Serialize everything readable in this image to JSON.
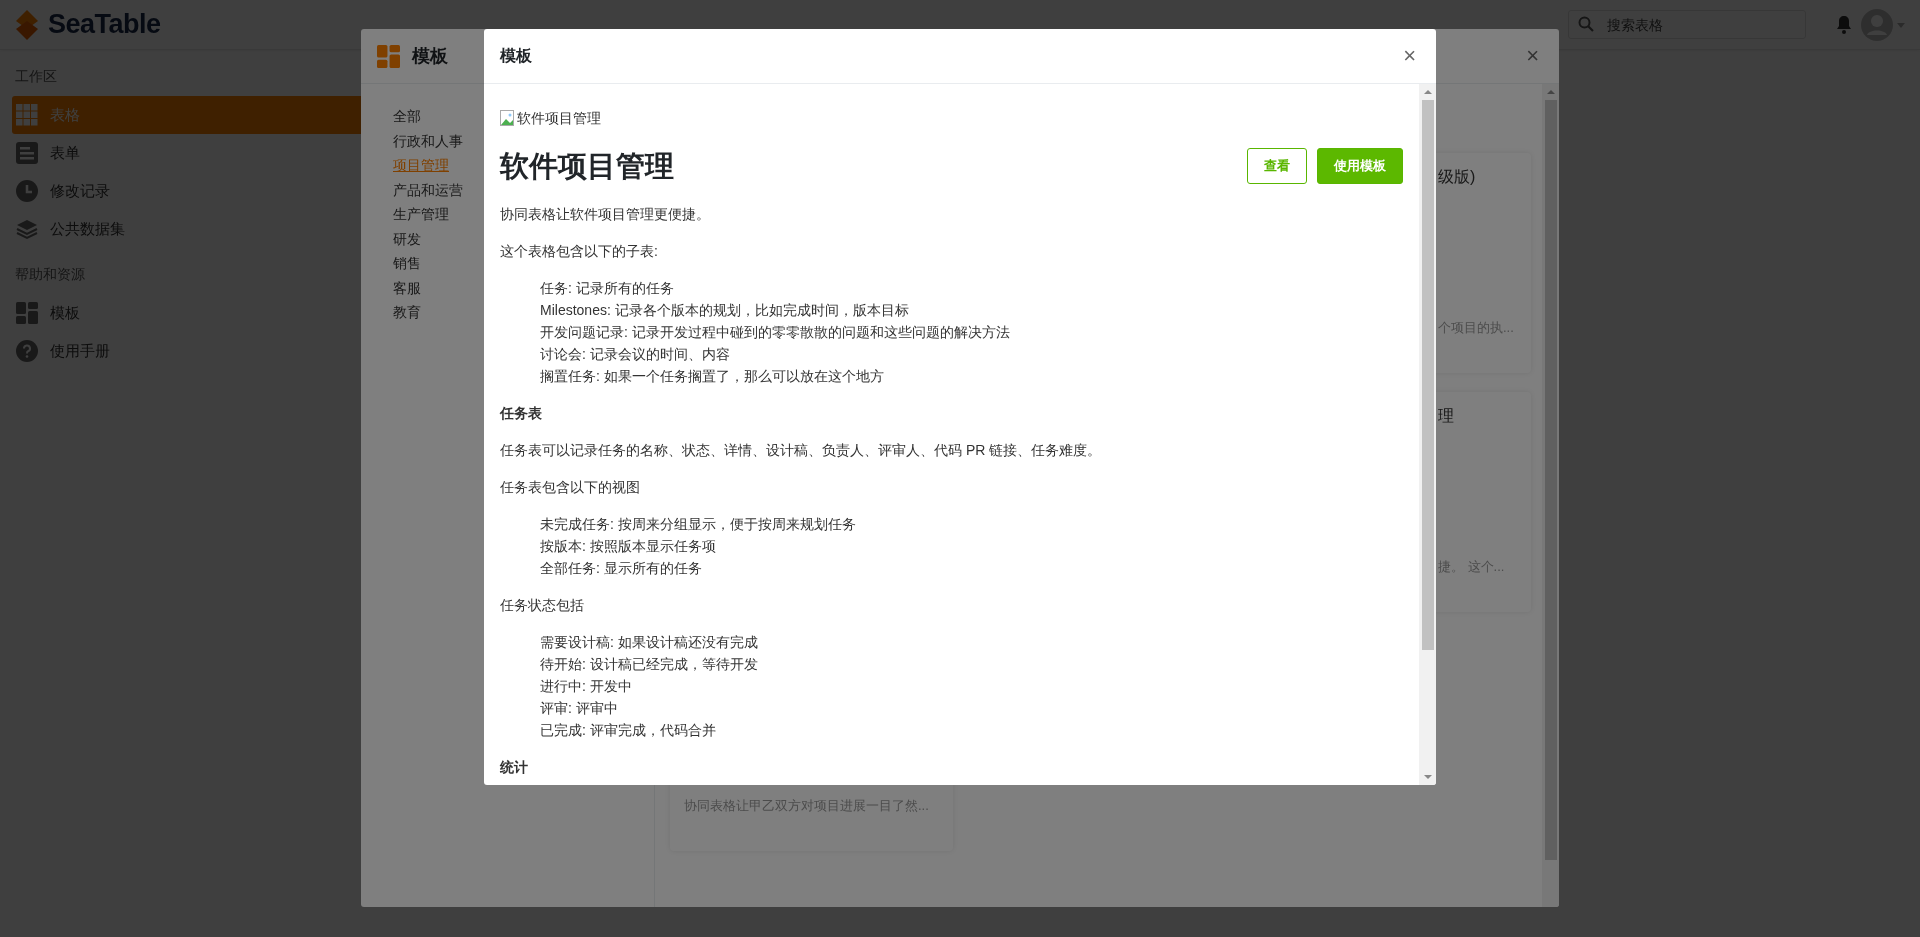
{
  "app": {
    "logo": "SeaTable",
    "search": {
      "placeholder": "搜索表格"
    },
    "sidebar": {
      "sections": [
        {
          "title": "工作区",
          "items": [
            {
              "label": "表格",
              "selected": true
            },
            {
              "label": "表单",
              "selected": false
            },
            {
              "label": "修改记录",
              "selected": false
            },
            {
              "label": "公共数据集",
              "selected": false
            }
          ]
        },
        {
          "title": "帮助和资源",
          "items": [
            {
              "label": "模板",
              "selected": false
            },
            {
              "label": "使用手册",
              "selected": false
            }
          ]
        }
      ]
    }
  },
  "templates_dialog": {
    "title": "模板",
    "close": "×",
    "categories": [
      {
        "label": "全部",
        "selected": false
      },
      {
        "label": "行政和人事",
        "selected": false
      },
      {
        "label": "项目管理",
        "selected": true
      },
      {
        "label": "产品和运营",
        "selected": false
      },
      {
        "label": "生产管理",
        "selected": false
      },
      {
        "label": "研发",
        "selected": false
      },
      {
        "label": "销售",
        "selected": false
      },
      {
        "label": "客服",
        "selected": false
      },
      {
        "label": "教育",
        "selected": false
      }
    ],
    "cards": [
      {
        "title": "级版)",
        "description": "个项目的执..."
      },
      {
        "title": "理",
        "description": "捷。 这个..."
      },
      {
        "description": "协同表格让甲乙双方对项目进展一目了然..."
      }
    ]
  },
  "detail_dialog": {
    "title": "模板",
    "close": "×",
    "image_alt": "软件项目管理",
    "heading": "软件项目管理",
    "buttons": [
      {
        "label": "查看",
        "kind": "outline"
      },
      {
        "label": "使用模板",
        "kind": "primary"
      }
    ],
    "content": [
      {
        "kind": "paragraph",
        "text": "协同表格让软件项目管理更便捷。"
      },
      {
        "kind": "paragraph",
        "text": "这个表格包含以下的子表:"
      },
      {
        "kind": "list",
        "items": [
          "任务: 记录所有的任务",
          "Milestones: 记录各个版本的规划，比如完成时间，版本目标",
          "开发问题记录: 记录开发过程中碰到的零零散散的问题和这些问题的解决方法",
          "讨论会: 记录会议的时间、内容",
          "搁置任务: 如果一个任务搁置了，那么可以放在这个地方"
        ]
      },
      {
        "kind": "heading",
        "text": "任务表"
      },
      {
        "kind": "paragraph",
        "text": "任务表可以记录任务的名称、状态、详情、设计稿、负责人、评审人、代码 PR 链接、任务难度。"
      },
      {
        "kind": "paragraph",
        "text": "任务表包含以下的视图"
      },
      {
        "kind": "list",
        "items": [
          "未完成任务: 按周来分组显示，便于按周来规划任务",
          "按版本: 按照版本显示任务项",
          "全部任务: 显示所有的任务"
        ]
      },
      {
        "kind": "paragraph",
        "text": "任务状态包括"
      },
      {
        "kind": "list",
        "items": [
          "需要设计稿: 如果设计稿还没有完成",
          "待开始: 设计稿已经完成，等待开发",
          "进行中: 开发中",
          "评审: 评审中",
          "已完成: 评审完成，代码合并"
        ]
      },
      {
        "kind": "heading",
        "text": "统计"
      }
    ]
  }
}
